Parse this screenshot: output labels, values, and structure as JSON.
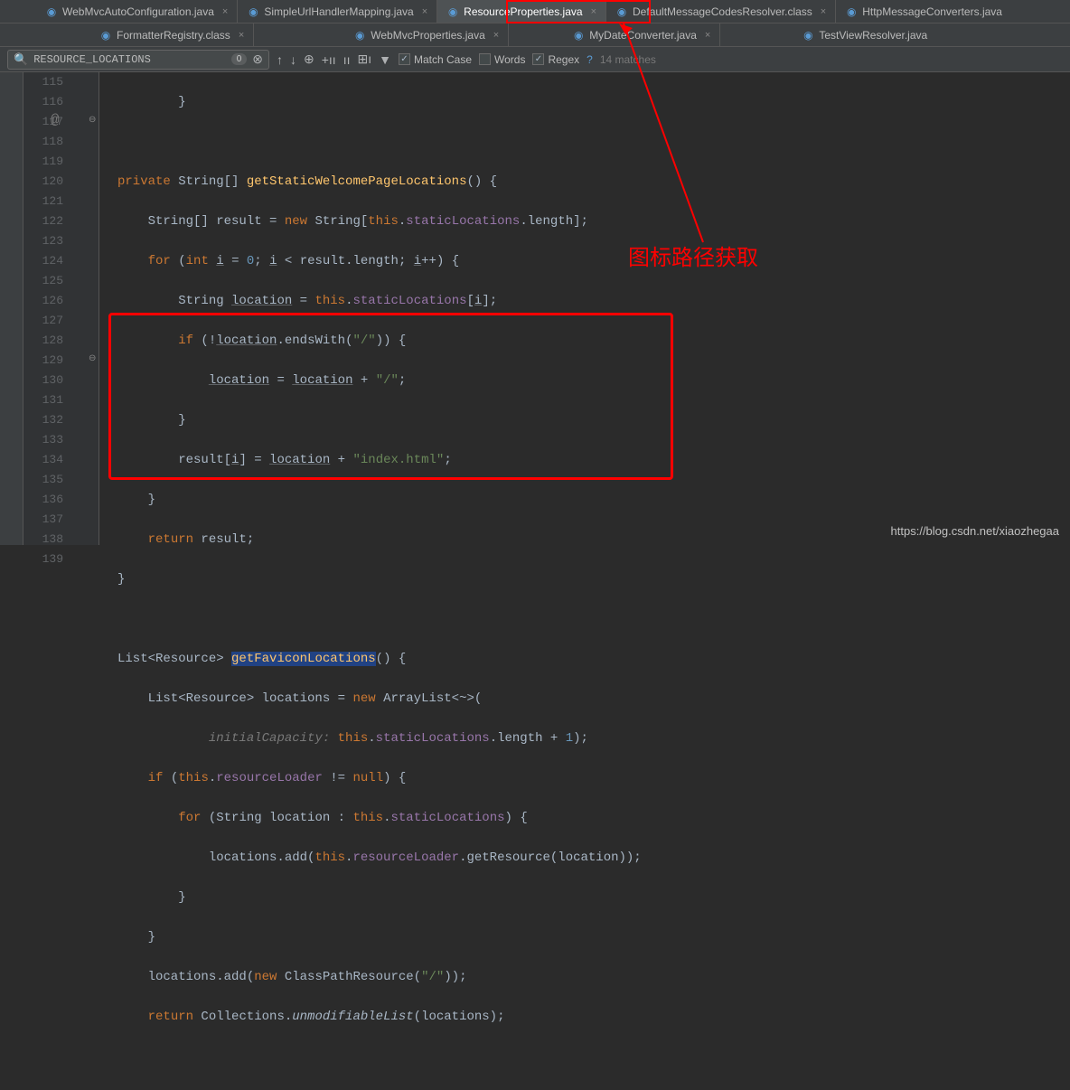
{
  "tabs": {
    "row1": [
      {
        "label": "WebMvcAutoConfiguration.java",
        "icon": "java"
      },
      {
        "label": "SimpleUrlHandlerMapping.java",
        "icon": "java"
      },
      {
        "label": "ResourceProperties.java",
        "icon": "java",
        "active": true
      },
      {
        "label": "DefaultMessageCodesResolver.class",
        "icon": "class"
      },
      {
        "label": "HttpMessageConverters.java",
        "icon": "java"
      }
    ],
    "row2": [
      {
        "label": "FormatterRegistry.class",
        "icon": "class"
      },
      {
        "label": "WebMvcProperties.java",
        "icon": "java"
      },
      {
        "label": "MyDateConverter.java",
        "icon": "java"
      },
      {
        "label": "TestViewResolver.java",
        "icon": "java"
      }
    ]
  },
  "search": {
    "value": "RESOURCE_LOCATIONS",
    "match_case": "Match Case",
    "words": "Words",
    "regex": "Regex",
    "matches": "14 matches",
    "pill": "0"
  },
  "lines": {
    "start": 115,
    "end": 139
  },
  "code": {
    "l115": "        }",
    "l116": "",
    "l117_kw": "private",
    "l117_type": " String[] ",
    "l117_method": "getStaticWelcomePageLocations",
    "l117_rest": "() {",
    "l118_a": "    String[] result = ",
    "l118_new": "new",
    "l118_b": " String[",
    "l118_this": "this",
    "l118_c": ".",
    "l118_field": "staticLocations",
    "l118_d": ".length];",
    "l119_for": "for",
    "l119_a": " (",
    "l119_int": "int",
    "l119_b": " ",
    "l119_i1": "i",
    "l119_c": " = ",
    "l119_zero": "0",
    "l119_d": "; ",
    "l119_i2": "i",
    "l119_e": " < result.length; ",
    "l119_i3": "i",
    "l119_f": "++) {",
    "l120_a": "        String ",
    "l120_loc": "location",
    "l120_b": " = ",
    "l120_this": "this",
    "l120_c": ".",
    "l120_field": "staticLocations",
    "l120_d": "[",
    "l120_i": "i",
    "l120_e": "];",
    "l121_if": "if",
    "l121_a": " (!",
    "l121_loc": "location",
    "l121_b": ".endsWith(",
    "l121_str": "\"/\"",
    "l121_c": ")) {",
    "l122_a": "            ",
    "l122_loc1": "location",
    "l122_b": " = ",
    "l122_loc2": "location",
    "l122_c": " + ",
    "l122_str": "\"/\"",
    "l122_d": ";",
    "l123": "        }",
    "l124_a": "        result[",
    "l124_i": "i",
    "l124_b": "] = ",
    "l124_loc": "location",
    "l124_c": " + ",
    "l124_str": "\"index.html\"",
    "l124_d": ";",
    "l125": "    }",
    "l126_ret": "return",
    "l126_a": " result;",
    "l127": "}",
    "l128": "",
    "l129_a": "List<Resource> ",
    "l129_method": "getFaviconLocations",
    "l129_b": "() {",
    "l130_a": "    List<Resource> locations = ",
    "l130_new": "new",
    "l130_b": " ArrayList<~>(",
    "l131_hint": "initialCapacity:",
    "l131_this": " this",
    "l131_a": ".",
    "l131_field": "staticLocations",
    "l131_b": ".length + ",
    "l131_one": "1",
    "l131_c": ");",
    "l132_if": "if",
    "l132_a": " (",
    "l132_this": "this",
    "l132_b": ".",
    "l132_field": "resourceLoader",
    "l132_c": " != ",
    "l132_null": "null",
    "l132_d": ") {",
    "l133_for": "for",
    "l133_a": " (String location : ",
    "l133_this": "this",
    "l133_b": ".",
    "l133_field": "staticLocations",
    "l133_c": ") {",
    "l134_a": "            locations.add(",
    "l134_this": "this",
    "l134_b": ".",
    "l134_field": "resourceLoader",
    "l134_c": ".getResource(location));",
    "l135": "        }",
    "l136": "    }",
    "l137_a": "    locations.add(",
    "l137_new": "new",
    "l137_b": " ClassPathResource(",
    "l137_str": "\"/\"",
    "l137_c": "));",
    "l138_ret": "return",
    "l138_a": " Collections.",
    "l138_method": "unmodifiableList",
    "l138_b": "(locations);",
    "l139": ""
  },
  "annotation": "图标路径获取",
  "watermark": "https://blog.csdn.net/xiaozhegaa"
}
